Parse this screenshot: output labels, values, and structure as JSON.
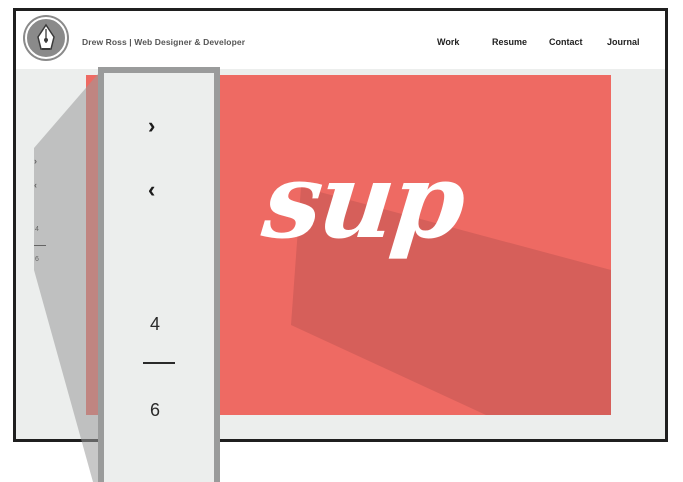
{
  "header": {
    "logo_icon": "pen-nib-logo-icon",
    "site_title": "Drew Ross | Web Designer & Developer",
    "nav": [
      {
        "label": "Work"
      },
      {
        "label": "Resume"
      },
      {
        "label": "Contact"
      },
      {
        "label": "Journal"
      }
    ]
  },
  "slider": {
    "next_glyph": "›",
    "prev_glyph": "‹",
    "next_icon": "chevron-right-icon",
    "prev_icon": "chevron-left-icon",
    "current": "4",
    "total": "6"
  },
  "hero": {
    "word": "sup",
    "background_color": "#ee6a63",
    "shadow_color": "#d65f5a",
    "text_color": "#ffffff"
  },
  "zoom": {
    "next_glyph": "›",
    "prev_glyph": "‹",
    "current": "4",
    "total": "6"
  },
  "colors": {
    "frame": "#1f1f1f",
    "page_background": "#eceeed",
    "callout": "#9a9b9b"
  }
}
